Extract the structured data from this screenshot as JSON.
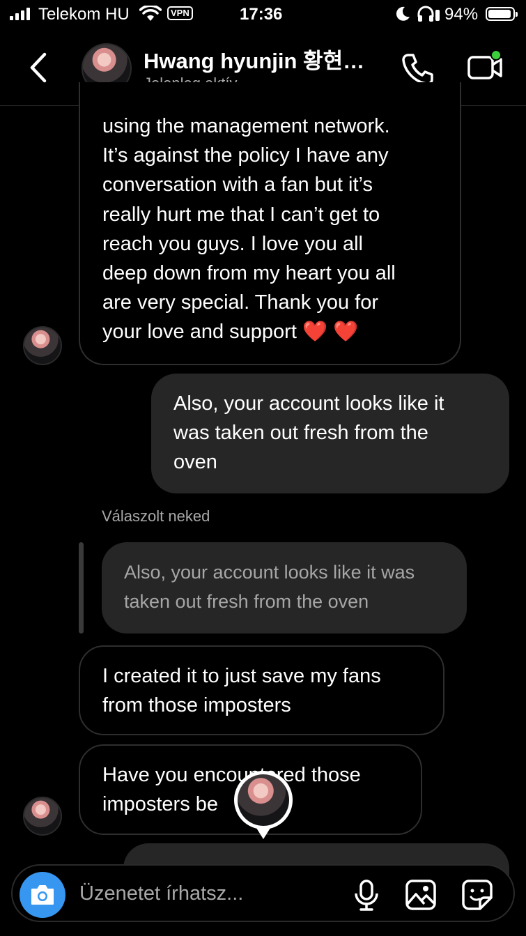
{
  "status_bar": {
    "carrier": "Telekom HU",
    "vpn_label": "VPN",
    "time": "17:36",
    "battery_percent": "94%",
    "battery_level": 0.94
  },
  "header": {
    "contact_name": "Hwang hyunjin 황현…",
    "contact_status": "Jelenleg aktív"
  },
  "messages": [
    {
      "direction": "incoming",
      "lines": [
        "using the management network.",
        "It’s against the policy I have any",
        "conversation with a fan but it’s",
        "really hurt me that I can’t get to",
        "reach you guys. I love you all",
        "deep down from my heart you all",
        "are very special. Thank you for",
        "your love and support ❤️ ❤️"
      ]
    },
    {
      "direction": "outgoing",
      "lines": [
        "Also, your account looks like it",
        "was taken out fresh from the",
        "oven"
      ]
    },
    {
      "direction": "incoming",
      "reply_label": "Válaszolt neked",
      "quoted_lines": [
        "Also, your account looks like it was",
        "taken out fresh from the oven"
      ],
      "lines": [
        "I created it to just save my fans",
        "from those imposters"
      ]
    },
    {
      "direction": "incoming",
      "lines": [
        "Have you encountered those",
        "imposters be"
      ]
    }
  ],
  "composer": {
    "placeholder": "Üzenetet írhatsz..."
  },
  "colors": {
    "background": "#000000",
    "outgoing_bubble": "#262626",
    "incoming_border": "#2e2e2e",
    "camera_button": "#3797f0",
    "active_dot": "#3ccf3c",
    "secondary_text": "#a8a8a8"
  },
  "icons": [
    "signal-icon",
    "wifi-icon",
    "moon-icon",
    "headphones-icon",
    "battery-icon",
    "back-chevron-icon",
    "phone-icon",
    "video-call-icon",
    "camera-icon",
    "microphone-icon",
    "gallery-icon",
    "sticker-icon"
  ]
}
